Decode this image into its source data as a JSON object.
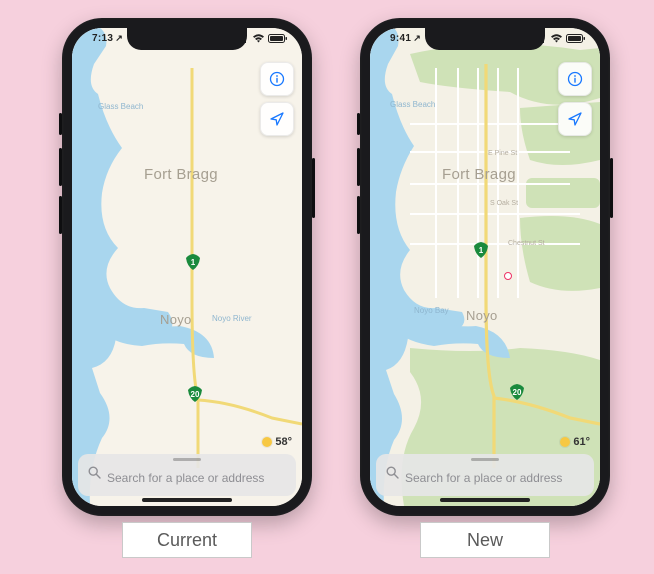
{
  "captions": {
    "left": "Current",
    "right": "New"
  },
  "phones": {
    "left": {
      "status": {
        "time": "7:13",
        "location_arrow": "↗"
      },
      "weather": {
        "temp": "58°"
      },
      "search": {
        "placeholder": "Search for a place or address"
      },
      "labels": {
        "fort_bragg": "Fort Bragg",
        "noyo": "Noyo",
        "glass_beach": "Glass Beach",
        "noyo_river": "Noyo River"
      },
      "shields": {
        "route1": "1",
        "route20": "20"
      }
    },
    "right": {
      "status": {
        "time": "9:41",
        "location_arrow": "↗"
      },
      "weather": {
        "temp": "61°"
      },
      "search": {
        "placeholder": "Search for a place or address"
      },
      "labels": {
        "fort_bragg": "Fort Bragg",
        "noyo": "Noyo",
        "glass_beach": "Glass Beach",
        "noyo_bay": "Noyo Bay",
        "pine_st": "E Pine St",
        "oak_st": "S Oak St",
        "chestnut_st": "Chestnut St"
      },
      "shields": {
        "route1": "1",
        "route20": "20"
      }
    }
  },
  "icons": {
    "info": "info-icon",
    "locate": "location-arrow-icon",
    "search": "search-icon",
    "weather": "sun-icon"
  }
}
